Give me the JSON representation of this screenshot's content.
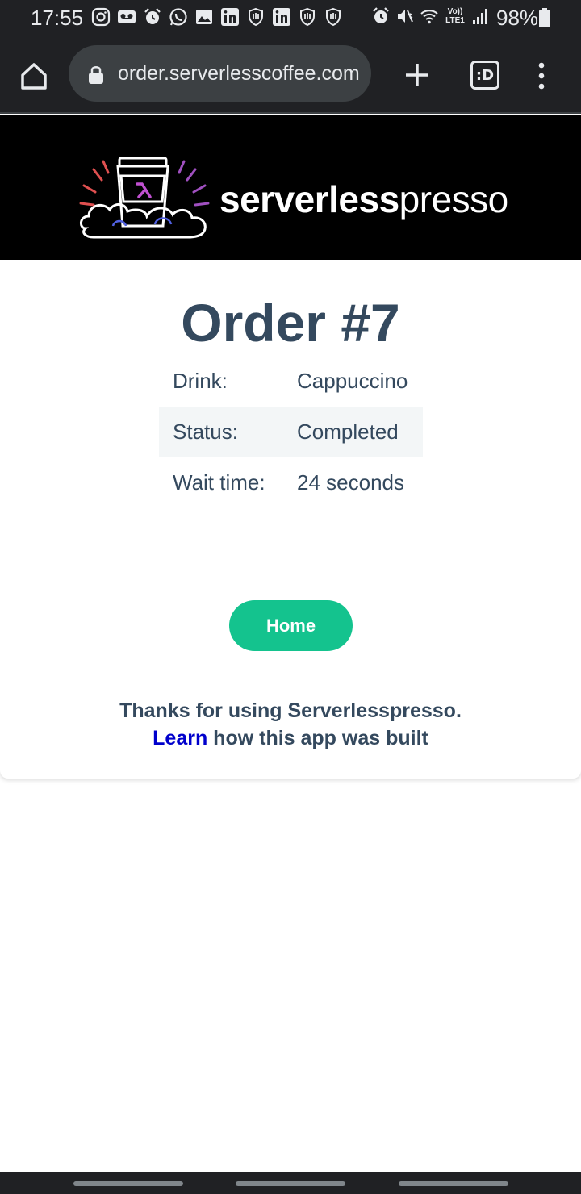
{
  "status_bar": {
    "time": "17:55",
    "battery": "98%",
    "left_icons": [
      "instagram-icon",
      "voicemail-icon",
      "alarm-icon",
      "whatsapp-icon",
      "gallery-icon",
      "linkedin-icon",
      "shield-icon",
      "linkedin-icon",
      "shield-icon",
      "shield-icon"
    ],
    "right_icons": [
      "alarm-icon",
      "mute-icon",
      "wifi-icon",
      "volte-icon",
      "signal-icon",
      "battery-icon"
    ],
    "volte_label": "Vo)) LTE1"
  },
  "browser": {
    "url": "order.serverlesscoffee.com",
    "tabs_label": ":D"
  },
  "banner": {
    "brand_bold": "serverless",
    "brand_light": "presso"
  },
  "order": {
    "title": "Order #7",
    "rows": [
      {
        "label": "Drink:",
        "value": "Cappuccino"
      },
      {
        "label": "Status:",
        "value": "Completed"
      },
      {
        "label": "Wait time:",
        "value": "24 seconds"
      }
    ]
  },
  "actions": {
    "home_label": "Home"
  },
  "footer": {
    "thanks_text": "Thanks for using Serverlesspresso.",
    "learn_link": "Learn",
    "learn_suffix": " how this app was built"
  },
  "colors": {
    "accent_green": "#14c38e",
    "heading": "#34495e",
    "link": "#0000cc",
    "banner_bg": "#000000",
    "chrome_bg": "#202124"
  }
}
